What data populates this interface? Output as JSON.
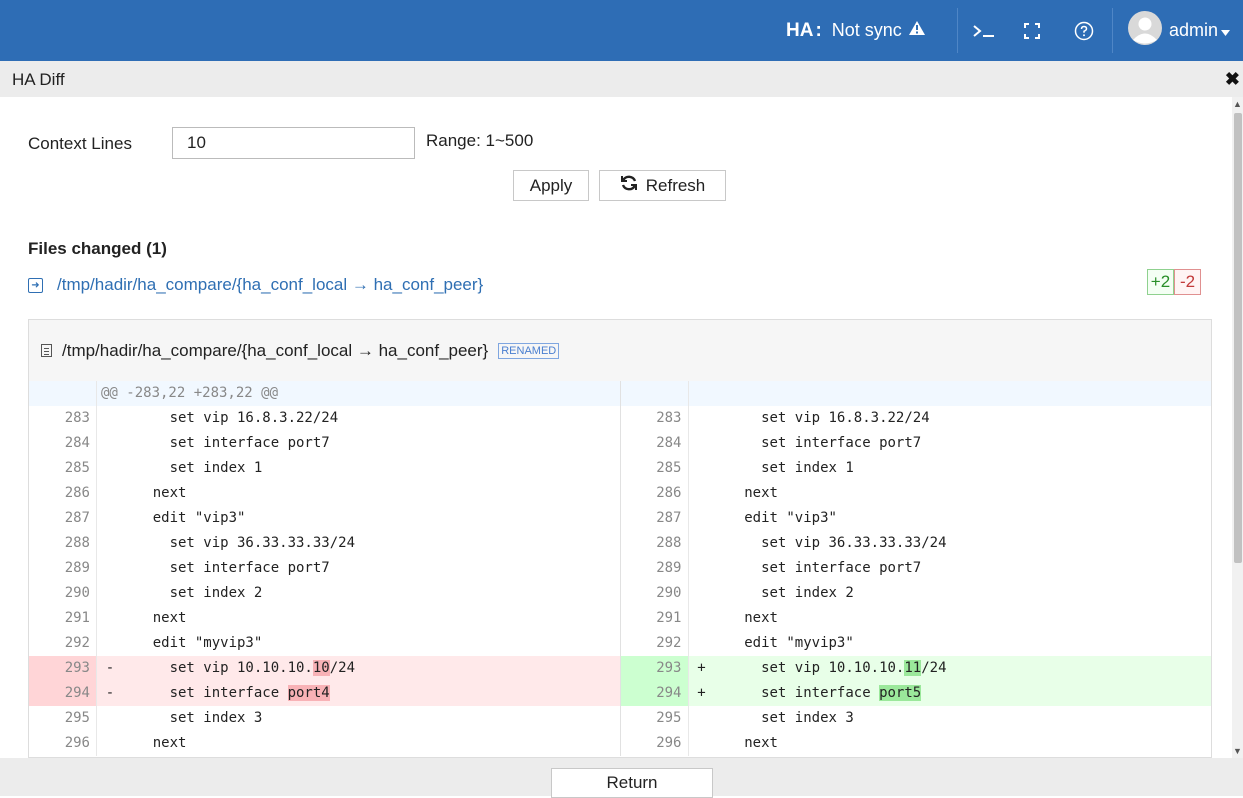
{
  "topbar": {
    "ha_label": "HA",
    "ha_colon": ":",
    "ha_status": "Not sync",
    "user": "admin"
  },
  "dialog": {
    "title": "HA Diff"
  },
  "form": {
    "context_label": "Context Lines",
    "context_value": "10",
    "range_label": "Range: 1~500",
    "apply_label": "Apply",
    "refresh_label": "Refresh"
  },
  "files": {
    "title": "Files changed (1)",
    "file_path": "/tmp/hadir/ha_compare/{ha_conf_local → ha_conf_peer}",
    "additions": "+2",
    "deletions": "-2"
  },
  "diff": {
    "file_path": "/tmp/hadir/ha_compare/{ha_conf_local → ha_conf_peer}",
    "badge": "RENAMED",
    "hunk": "@@ -283,22 +283,22 @@",
    "rows": [
      {
        "ln": "283",
        "code": "      set vip 16.8.3.22/24"
      },
      {
        "ln": "284",
        "code": "      set interface port7"
      },
      {
        "ln": "285",
        "code": "      set index 1"
      },
      {
        "ln": "286",
        "code": "    next"
      },
      {
        "ln": "287",
        "code": "    edit \"vip3\""
      },
      {
        "ln": "288",
        "code": "      set vip 36.33.33.33/24"
      },
      {
        "ln": "289",
        "code": "      set interface port7"
      },
      {
        "ln": "290",
        "code": "      set index 2"
      },
      {
        "ln": "291",
        "code": "    next"
      },
      {
        "ln": "292",
        "code": "    edit \"myvip3\""
      }
    ],
    "changed": [
      {
        "ln": "293",
        "del_marker": "-",
        "ins_marker": "+",
        "prefix": "      set vip 10.10.10.",
        "del_hl": "10",
        "ins_hl": "11",
        "suffix": "/24"
      },
      {
        "ln": "294",
        "del_marker": "-",
        "ins_marker": "+",
        "prefix": "      set interface ",
        "del_hl": "port4",
        "ins_hl": "port5",
        "suffix": ""
      }
    ],
    "rows_after": [
      {
        "ln": "295",
        "code": "      set index 3"
      },
      {
        "ln": "296",
        "code": "    next"
      }
    ]
  },
  "footer": {
    "return_label": "Return"
  },
  "colors": {
    "topbar": "#2e6db5",
    "link": "#2f6fb3",
    "deleted_bg": "#ffe9ea",
    "inserted_bg": "#e8ffe8"
  }
}
